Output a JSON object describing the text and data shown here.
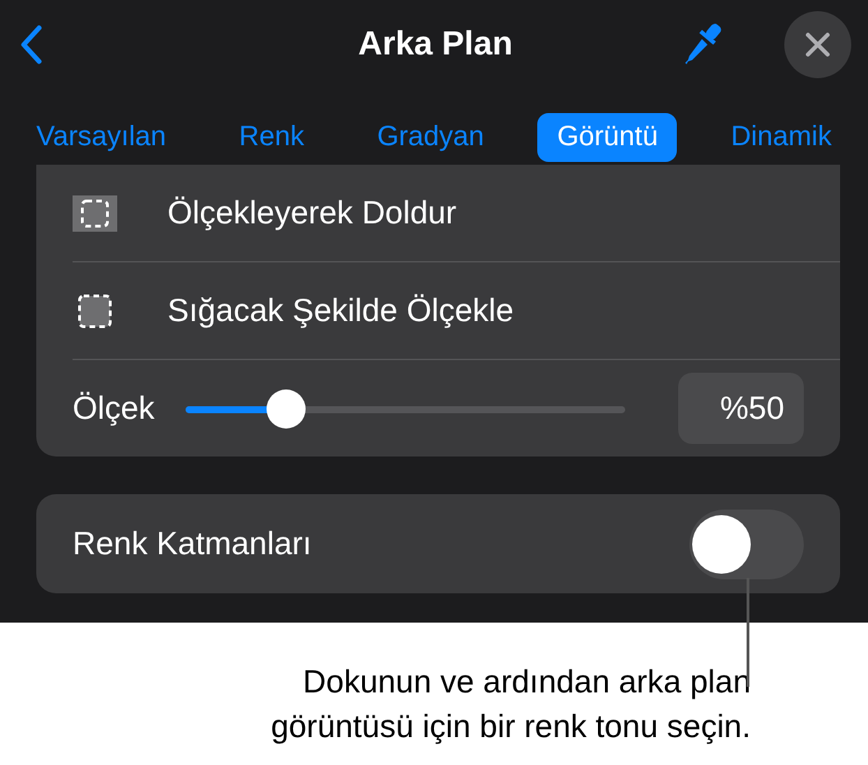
{
  "header": {
    "title": "Arka Plan"
  },
  "tabs": [
    {
      "label": "Varsayılan",
      "selected": false
    },
    {
      "label": "Renk",
      "selected": false
    },
    {
      "label": "Gradyan",
      "selected": false
    },
    {
      "label": "Görüntü",
      "selected": true
    },
    {
      "label": "Dinamik",
      "selected": false
    }
  ],
  "scale_options": [
    {
      "kind": "fill",
      "label": "Ölçekleyerek Doldur"
    },
    {
      "kind": "fit",
      "label": "Sığacak Şekilde Ölçekle"
    }
  ],
  "scale": {
    "label": "Ölçek",
    "level": 0.23,
    "reading": "%50"
  },
  "color_overlay": {
    "label": "Renk Katmanları",
    "on": false
  },
  "callout": {
    "lines": [
      "Dokunun ve ardından arka plan",
      "görüntüsü için bir renk tonu seçin."
    ]
  }
}
